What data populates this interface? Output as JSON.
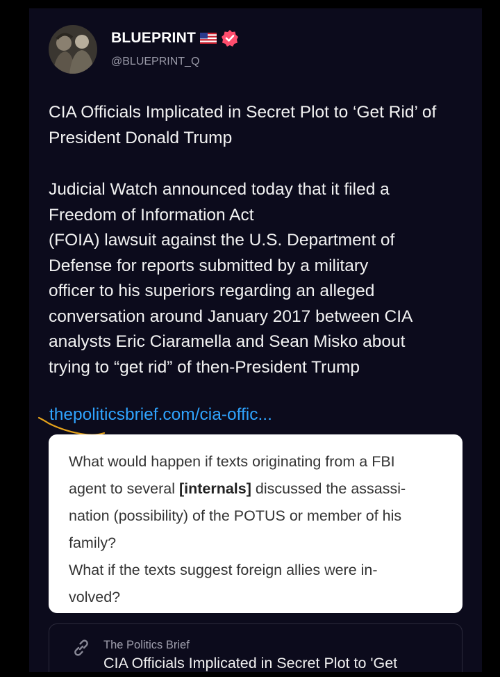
{
  "author": {
    "name": "BLUEPRINT",
    "flag_icon": "us-flag-icon",
    "badge_icon": "verified-badge-icon",
    "handle": "@BLUEPRINT_Q",
    "badge_color": "#ff4d6d"
  },
  "post": {
    "headline": "CIA Officials Implicated in Secret Plot to ‘Get Rid’ of President Donald Trump",
    "body_lines": [
      "Judicial Watch announced today that it filed a",
      "Freedom of Information Act",
      "(FOIA) lawsuit against the U.S. Department of",
      "Defense for reports submitted by a military",
      "officer to his superiors regarding an alleged",
      "conversation around January 2017 between CIA",
      "analysts Eric Ciaramella and Sean Misko about",
      "trying to “get rid” of then-President Trump"
    ],
    "link": "thepoliticsbrief.com/cia-offic..."
  },
  "quote": {
    "line1": "What would happen if texts originating from a FBI",
    "line2_pre": "agent to several ",
    "line2_bold": "[internals]",
    "line2_post": " discussed the assassi-",
    "line3": "nation (possibility) of the POTUS or member of his",
    "line4": "family?",
    "line5": "What if the texts suggest foreign allies were in-",
    "line6": "volved?"
  },
  "preview": {
    "icon": "link-icon",
    "source": "The Politics Brief",
    "title": "CIA Officials Implicated in Secret Plot to 'Get"
  },
  "colors": {
    "background": "#0c0b1c",
    "link": "#2fa4ff",
    "annotation": "#e5a21a"
  }
}
